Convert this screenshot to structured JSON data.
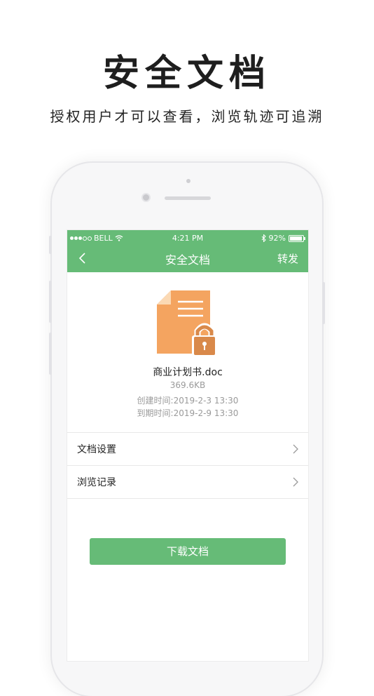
{
  "hero": {
    "title": "安全文档",
    "subtitle": "授权用户才可以查看，浏览轨迹可追溯"
  },
  "colors": {
    "accent": "#66bb77",
    "doc_orange": "#f4a460",
    "lock_orange": "#d9894a"
  },
  "status_bar": {
    "carrier": "BELL",
    "time": "4:21 PM",
    "battery": "92%",
    "battery_level": 0.92,
    "icons": [
      "signal-dots",
      "wifi-icon",
      "bluetooth-icon",
      "battery-icon"
    ]
  },
  "nav": {
    "title": "安全文档",
    "back_icon": "chevron-left-icon",
    "forward_label": "转发"
  },
  "document": {
    "icon": "locked-document-icon",
    "name": "商业计划书.doc",
    "size": "369.6KB",
    "created": "创建时间:2019-2-3 13:30",
    "expires": "到期时间:2019-2-9 13:30"
  },
  "menu": [
    {
      "label": "文档设置",
      "icon": "chevron-right-icon"
    },
    {
      "label": "浏览记录",
      "icon": "chevron-right-icon"
    }
  ],
  "download_label": "下载文档"
}
